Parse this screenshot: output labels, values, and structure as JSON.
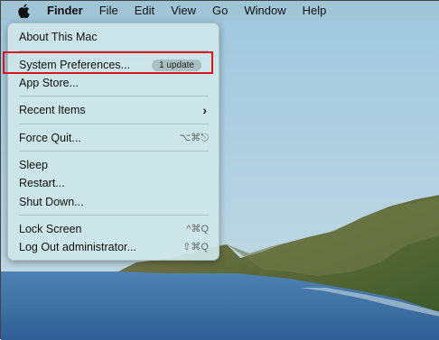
{
  "menubar": {
    "app": "Finder",
    "items": [
      "File",
      "Edit",
      "View",
      "Go",
      "Window",
      "Help"
    ]
  },
  "apple_menu": {
    "about": "About This Mac",
    "system_prefs": "System Preferences...",
    "update_badge": "1 update",
    "app_store": "App Store...",
    "recent_items": "Recent Items",
    "force_quit": "Force Quit...",
    "force_quit_shortcut": "⌥⌘⎋",
    "sleep": "Sleep",
    "restart": "Restart...",
    "shut_down": "Shut Down...",
    "lock_screen": "Lock Screen",
    "lock_screen_shortcut": "^⌘Q",
    "log_out": "Log Out administrator...",
    "log_out_shortcut": "⇧⌘Q"
  },
  "colors": {
    "highlight_border": "#d8141f",
    "sea": "#3f73a8",
    "sky": "#a9cde0"
  },
  "icons": [
    "apple-logo-icon",
    "chevron-right-icon"
  ]
}
